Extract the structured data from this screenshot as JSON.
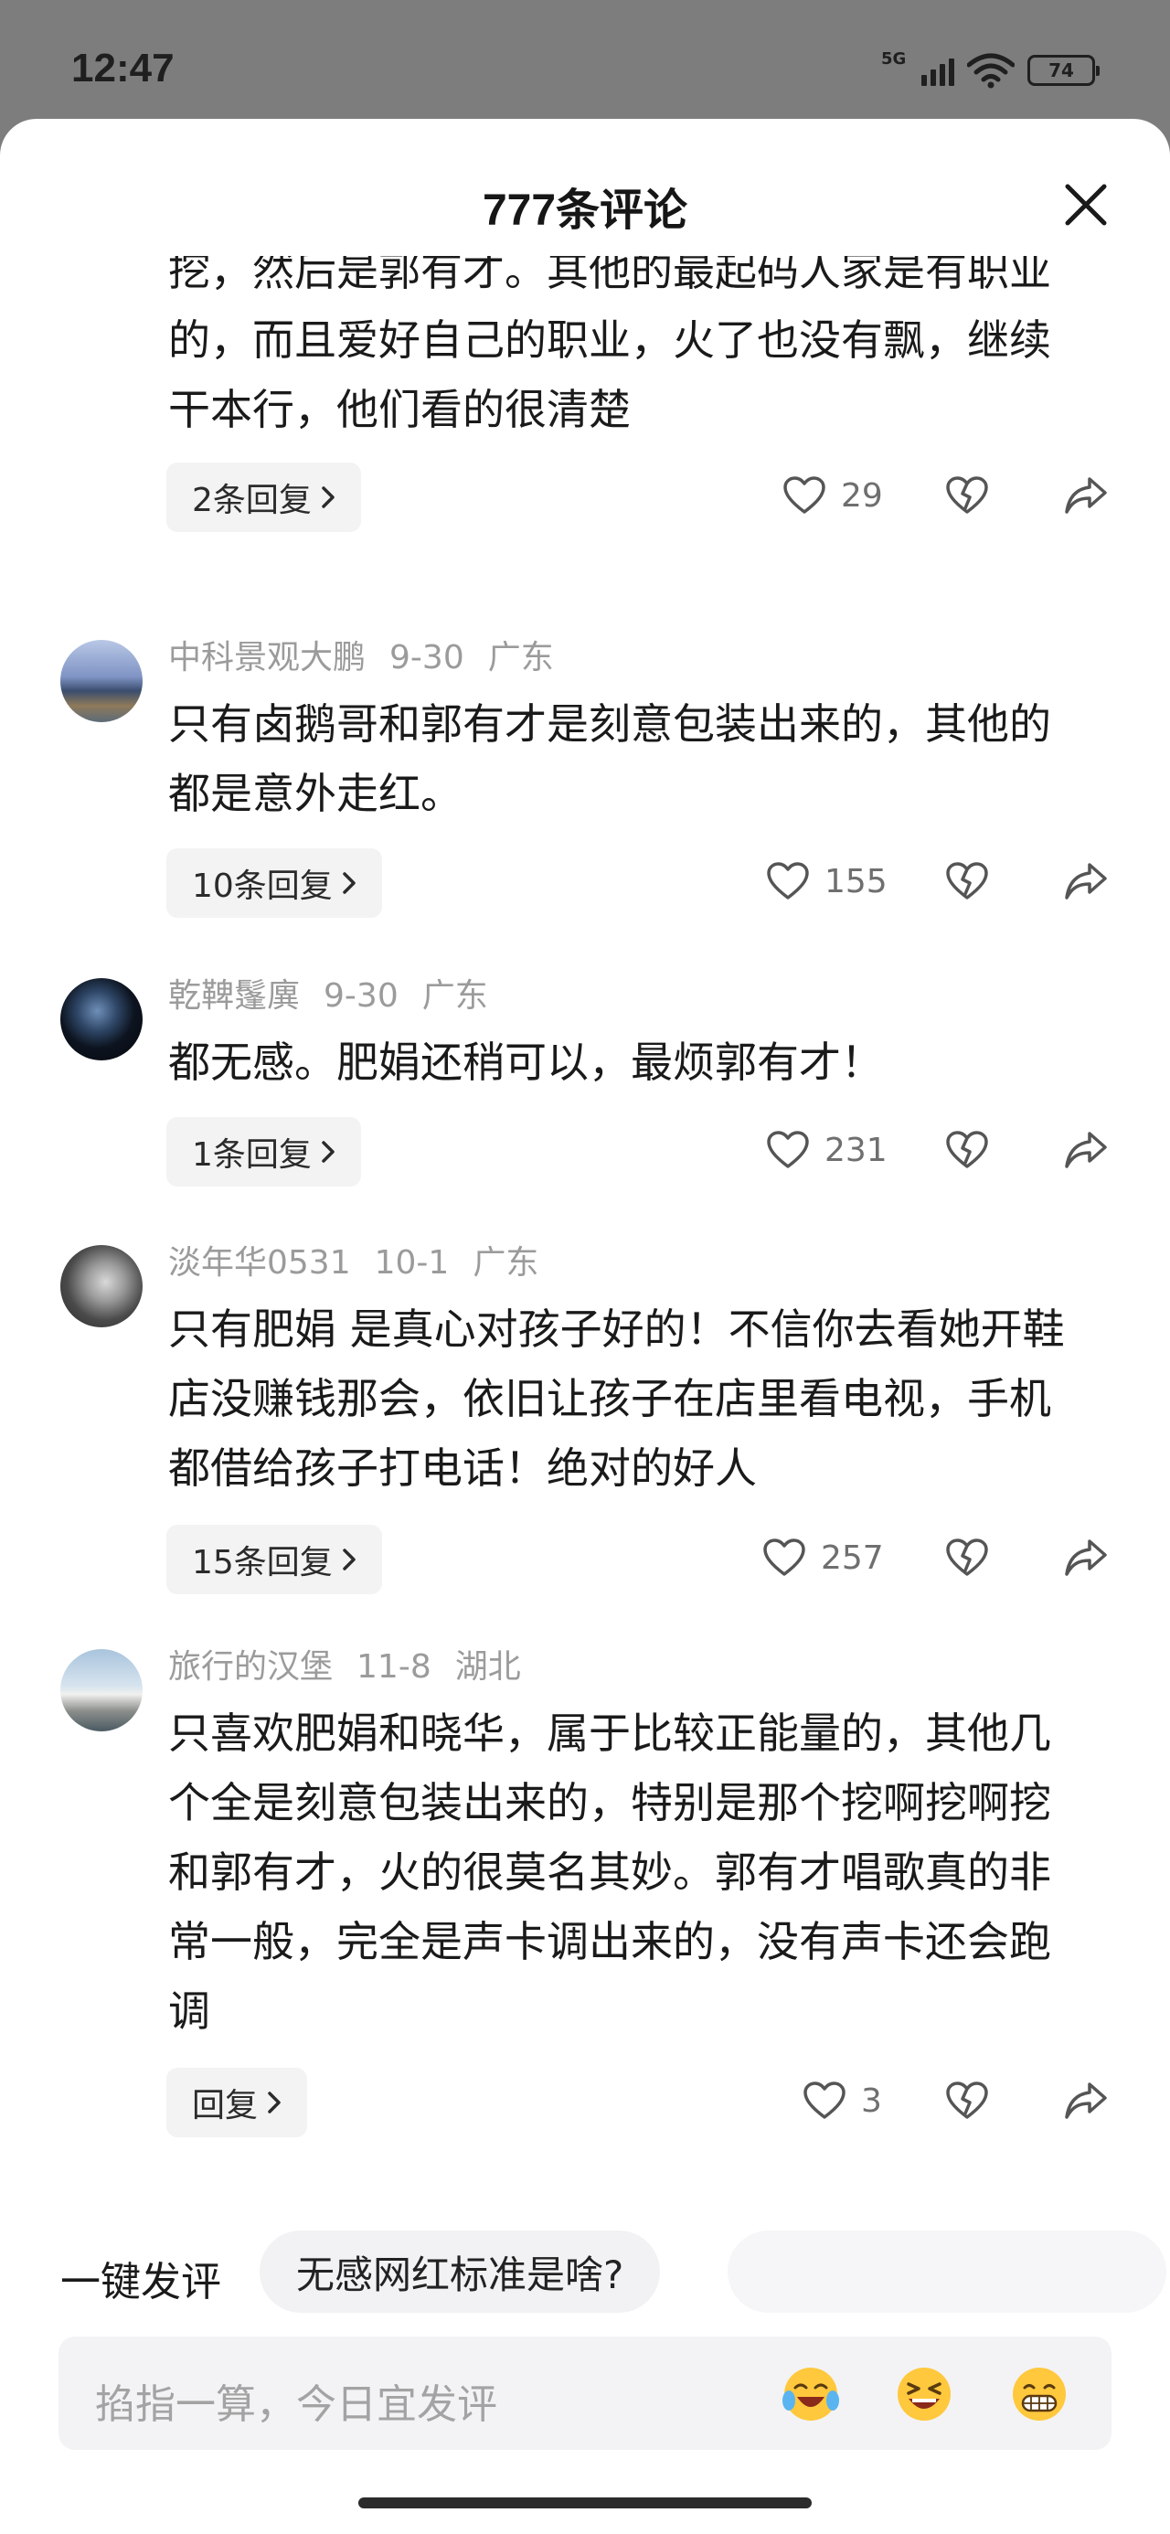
{
  "status_bar": {
    "time": "12:47",
    "network": "5G",
    "battery": "74"
  },
  "sheet": {
    "title": "777条评论"
  },
  "comments": [
    {
      "text": "陆鹅出名吗，第一次听说，无感的是那个挖呀挖，然后是郭有才。其他的最起码人家是有职业的，而且爱好自己的职业，火了也没有飘，继续干本行，他们看的很清楚",
      "replies": "2条回复",
      "likes": "29"
    },
    {
      "user": "中科景观大鹏",
      "date": "9-30",
      "location": "广东",
      "text": "只有卤鹅哥和郭有才是刻意包装出来的，其他的都是意外走红。",
      "replies": "10条回复",
      "likes": "155"
    },
    {
      "user": "乾鞞鬔廙",
      "date": "9-30",
      "location": "广东",
      "text": "都无感。肥娟还稍可以，最烦郭有才！",
      "replies": "1条回复",
      "likes": "231"
    },
    {
      "user": "淡年华0531",
      "date": "10-1",
      "location": "广东",
      "text": "只有肥娟 是真心对孩子好的！不信你去看她开鞋店没赚钱那会，依旧让孩子在店里看电视，手机都借给孩子打电话！绝对的好人",
      "replies": "15条回复",
      "likes": "257"
    },
    {
      "user": "旅行的汉堡",
      "date": "11-8",
      "location": "湖北",
      "text": "只喜欢肥娟和晓华，属于比较正能量的，其他几个全是刻意包装出来的，特别是那个挖啊挖啊挖和郭有才，火的很莫名其妙。郭有才唱歌真的非常一般，完全是声卡调出来的，没有声卡还会跑调",
      "replies": "回复",
      "likes": "3"
    }
  ],
  "quick_comment": {
    "label": "一键发评",
    "suggestion": "无感网红标准是啥?"
  },
  "input": {
    "placeholder": "掐指一算，今日宜发评"
  },
  "icons": {
    "close": "close-icon",
    "like": "heart-outline-icon",
    "dislike": "broken-heart-icon",
    "share": "share-arrow-icon",
    "emoji_1": "laughing-crying-emoji",
    "emoji_2": "grinning-squint-emoji",
    "emoji_3": "grimacing-grin-emoji"
  },
  "colors": {
    "sheet_background": "#ffffff",
    "backdrop": "#7d7d7d",
    "meta_text": "#9b9b9b",
    "pill_background": "#f3f3f4"
  }
}
